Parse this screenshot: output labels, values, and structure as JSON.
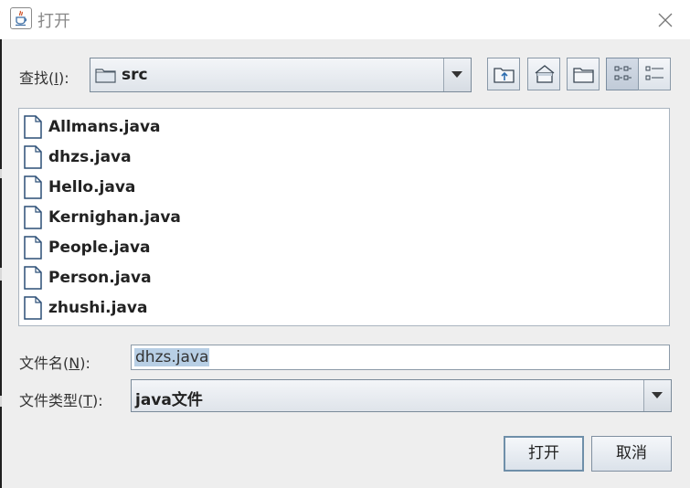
{
  "window": {
    "title": "打开"
  },
  "toolbar": {
    "look_in_label": "查找(",
    "look_in_mnemonic": "I",
    "look_in_suffix": "):",
    "current_folder": "src",
    "buttons": [
      "up-one-level-icon",
      "home-icon",
      "new-folder-icon",
      "list-view-icon",
      "details-view-icon"
    ]
  },
  "files": [
    "Allmans.java",
    "dhzs.java",
    "Hello.java",
    "Kernighan.java",
    "People.java",
    "Person.java",
    "zhushi.java"
  ],
  "filename": {
    "label_prefix": "文件名(",
    "mnemonic": "N",
    "label_suffix": "):",
    "value": "dhzs.java"
  },
  "filetype": {
    "label_prefix": "文件类型(",
    "mnemonic": "T",
    "label_suffix": "):",
    "value": "java文件"
  },
  "actions": {
    "open": "打开",
    "cancel": "取消"
  }
}
